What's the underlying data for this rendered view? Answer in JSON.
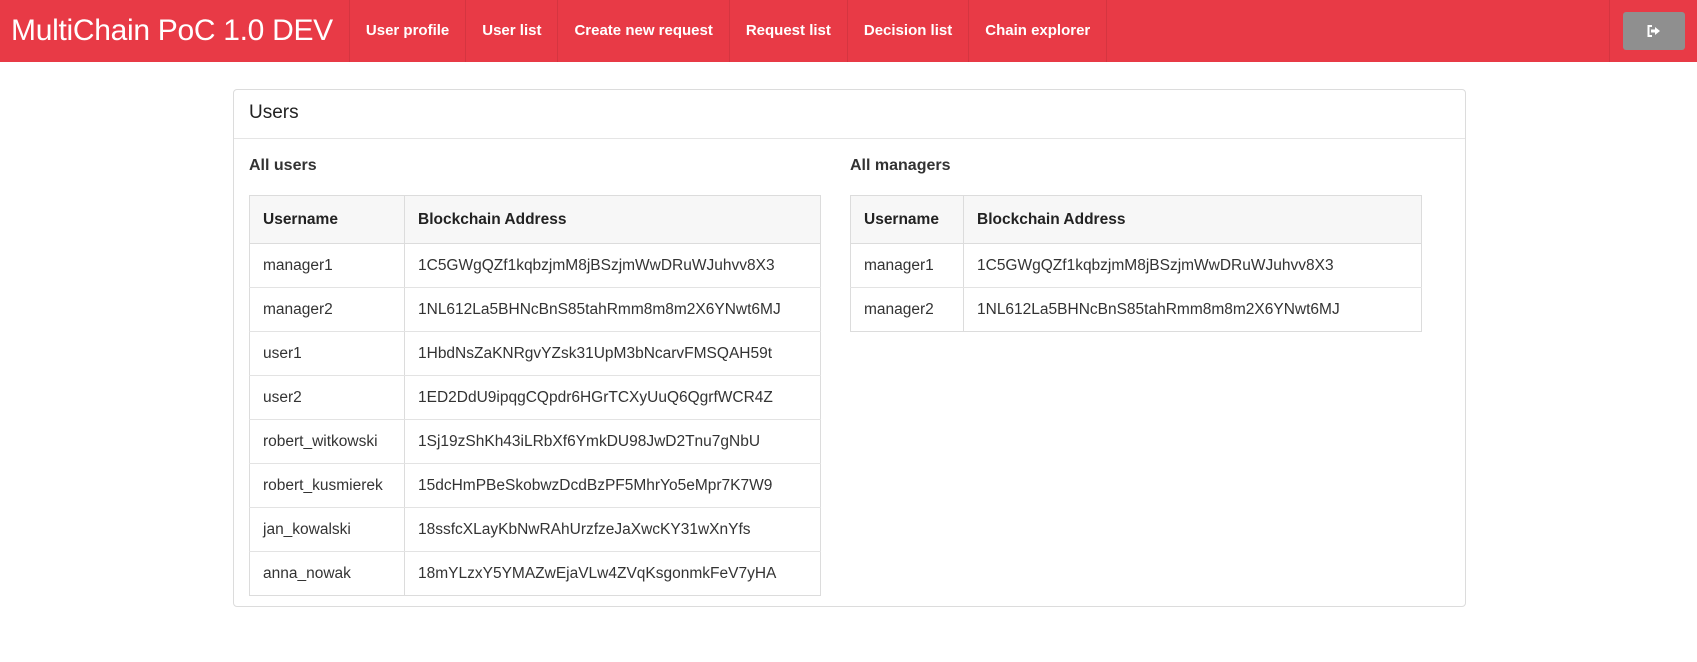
{
  "app": {
    "brand": "MultiChain PoC 1.0 DEV"
  },
  "nav": {
    "items": [
      {
        "label": "User profile"
      },
      {
        "label": "User list"
      },
      {
        "label": "Create new request"
      },
      {
        "label": "Request list"
      },
      {
        "label": "Decision list"
      },
      {
        "label": "Chain explorer"
      }
    ],
    "logout_icon": "sign-out-icon"
  },
  "panel": {
    "title": "Users",
    "all_users": {
      "title": "All users",
      "columns": [
        "Username",
        "Blockchain Address"
      ],
      "rows": [
        {
          "username": "manager1",
          "address": "1C5GWgQZf1kqbzjmM8jBSzjmWwDRuWJuhvv8X3"
        },
        {
          "username": "manager2",
          "address": "1NL612La5BHNcBnS85tahRmm8m8m2X6YNwt6MJ"
        },
        {
          "username": "user1",
          "address": "1HbdNsZaKNRgvYZsk31UpM3bNcarvFMSQAH59t"
        },
        {
          "username": "user2",
          "address": "1ED2DdU9ipqgCQpdr6HGrTCXyUuQ6QgrfWCR4Z"
        },
        {
          "username": "robert_witkowski",
          "address": "1Sj19zShKh43iLRbXf6YmkDU98JwD2Tnu7gNbU"
        },
        {
          "username": "robert_kusmierek",
          "address": "15dcHmPBeSkobwzDcdBzPF5MhrYo5eMpr7K7W9"
        },
        {
          "username": "jan_kowalski",
          "address": "18ssfcXLayKbNwRAhUrzfzeJaXwcKY31wXnYfs"
        },
        {
          "username": "anna_nowak",
          "address": "18mYLzxY5YMAZwEjaVLw4ZVqKsgonmkFeV7yHA"
        }
      ]
    },
    "all_managers": {
      "title": "All managers",
      "columns": [
        "Username",
        "Blockchain Address"
      ],
      "rows": [
        {
          "username": "manager1",
          "address": "1C5GWgQZf1kqbzjmM8jBSzjmWwDRuWJuhvv8X3"
        },
        {
          "username": "manager2",
          "address": "1NL612La5BHNcBnS85tahRmm8m8m2X6YNwt6MJ"
        }
      ]
    }
  }
}
